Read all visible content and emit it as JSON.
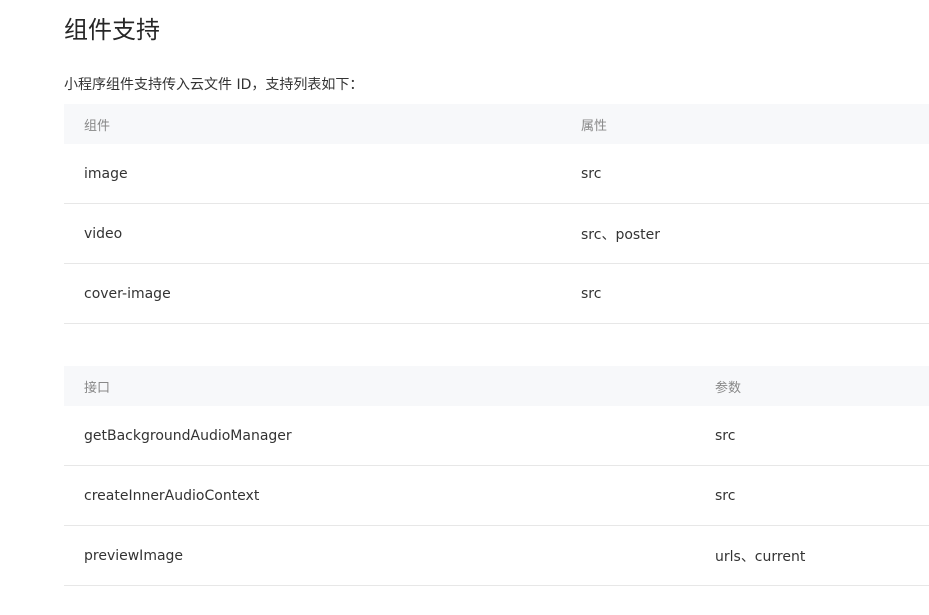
{
  "page": {
    "title": "组件支持",
    "intro": "小程序组件支持传入云文件 ID，支持列表如下："
  },
  "components_table": {
    "headers": [
      "组件",
      "属性"
    ],
    "rows": [
      [
        "image",
        "src"
      ],
      [
        "video",
        "src、poster"
      ],
      [
        "cover-image",
        "src"
      ]
    ]
  },
  "apis_table": {
    "headers": [
      "接口",
      "参数"
    ],
    "rows": [
      [
        "getBackgroundAudioManager",
        "src"
      ],
      [
        "createInnerAudioContext",
        "src"
      ],
      [
        "previewImage",
        "urls、current"
      ]
    ]
  },
  "colors": {
    "text": "#333333",
    "header_text": "#888888",
    "header_bg": "#f7f8fa",
    "row_border": "#e7e7e7"
  }
}
